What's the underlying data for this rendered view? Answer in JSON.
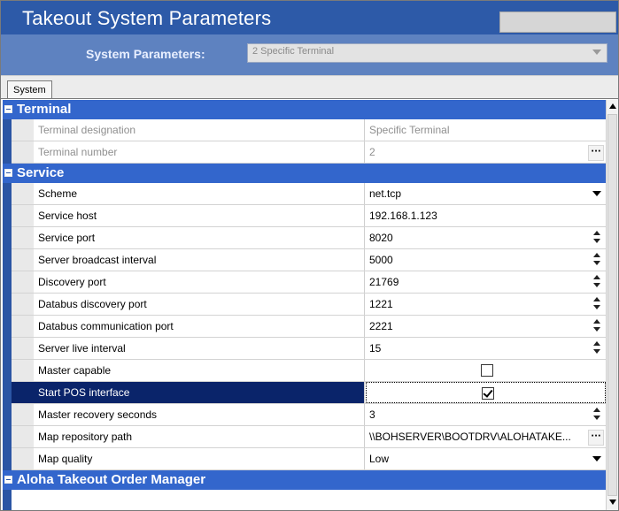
{
  "window": {
    "title": "Takeout System Parameters"
  },
  "system_params": {
    "label": "System Parameters:",
    "selected": "2 Specific Terminal"
  },
  "tabs": [
    {
      "label": "System"
    }
  ],
  "categories": {
    "terminal": "Terminal",
    "service": "Service",
    "aloha": "Aloha Takeout Order Manager"
  },
  "rows": {
    "terminal_designation": {
      "name": "Terminal designation",
      "value": "Specific Terminal"
    },
    "terminal_number": {
      "name": "Terminal number",
      "value": "2"
    },
    "scheme": {
      "name": "Scheme",
      "value": "net.tcp"
    },
    "service_host": {
      "name": "Service host",
      "value": "192.168.1.123"
    },
    "service_port": {
      "name": "Service port",
      "value": "8020"
    },
    "server_broadcast_interval": {
      "name": "Server broadcast interval",
      "value": "5000"
    },
    "discovery_port": {
      "name": "Discovery port",
      "value": "21769"
    },
    "databus_discovery_port": {
      "name": "Databus discovery port",
      "value": "1221"
    },
    "databus_communication_port": {
      "name": "Databus communication port",
      "value": "2221"
    },
    "server_live_interval": {
      "name": "Server live interval",
      "value": "15"
    },
    "master_capable": {
      "name": "Master capable",
      "checked": false
    },
    "start_pos_interface": {
      "name": "Start POS interface",
      "checked": true
    },
    "master_recovery_seconds": {
      "name": "Master recovery seconds",
      "value": "3"
    },
    "map_repository_path": {
      "name": "Map repository path",
      "value": "\\\\BOHSERVER\\BOOTDRV\\ALOHATAKE..."
    },
    "map_quality": {
      "name": "Map quality",
      "value": "Low"
    }
  },
  "icons": {
    "collapse": "minus-box-icon",
    "ellipsis": "ellipsis-button-icon",
    "dropdown": "chevron-down-icon",
    "spinner": "spinner-icon",
    "checkbox": "checkbox-icon"
  },
  "colors": {
    "title_bar": "#2d5aa8",
    "sysbar": "#5e82c0",
    "category": "#3366cc",
    "selected_row": "#0a246a"
  }
}
